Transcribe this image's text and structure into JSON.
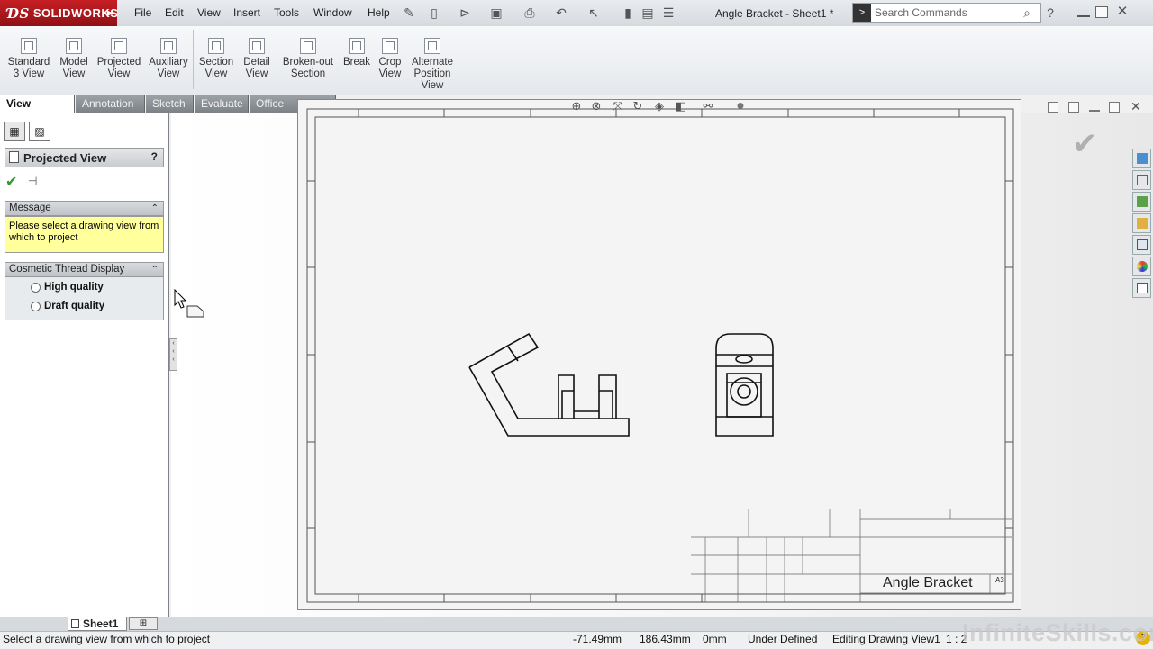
{
  "app": {
    "name": "SOLIDWORKS",
    "document_title": "Angle Bracket - Sheet1 *"
  },
  "menu": [
    "File",
    "Edit",
    "View",
    "Insert",
    "Tools",
    "Window",
    "Help"
  ],
  "search": {
    "placeholder": "Search Commands"
  },
  "ribbon": [
    {
      "label": "Standard 3 View"
    },
    {
      "label": "Model View"
    },
    {
      "label": "Projected View"
    },
    {
      "label": "Auxiliary View"
    },
    {
      "label": "Section View"
    },
    {
      "label": "Detail View"
    },
    {
      "label": "Broken-out Section"
    },
    {
      "label": "Break"
    },
    {
      "label": "Crop View"
    },
    {
      "label": "Alternate Position View"
    }
  ],
  "tabs": [
    "View Layout",
    "Annotation",
    "Sketch",
    "Evaluate",
    "Office Products"
  ],
  "property_manager": {
    "title": "Projected View",
    "help": "?",
    "message_header": "Message",
    "message_text": "Please select a drawing view from which to project",
    "thread_header": "Cosmetic Thread Display",
    "options": [
      "High quality",
      "Draft quality"
    ]
  },
  "title_block": {
    "part_name": "Angle Bracket",
    "size": "A3"
  },
  "sheet_tab": "Sheet1",
  "status": {
    "message": "Select a drawing view from which to project",
    "x": "-71.49mm",
    "y": "186.43mm",
    "z": "0mm",
    "state": "Under Defined",
    "editing": "Editing Drawing View1",
    "scale": "1 : 2"
  },
  "watermark": "InfiniteSkills.com"
}
